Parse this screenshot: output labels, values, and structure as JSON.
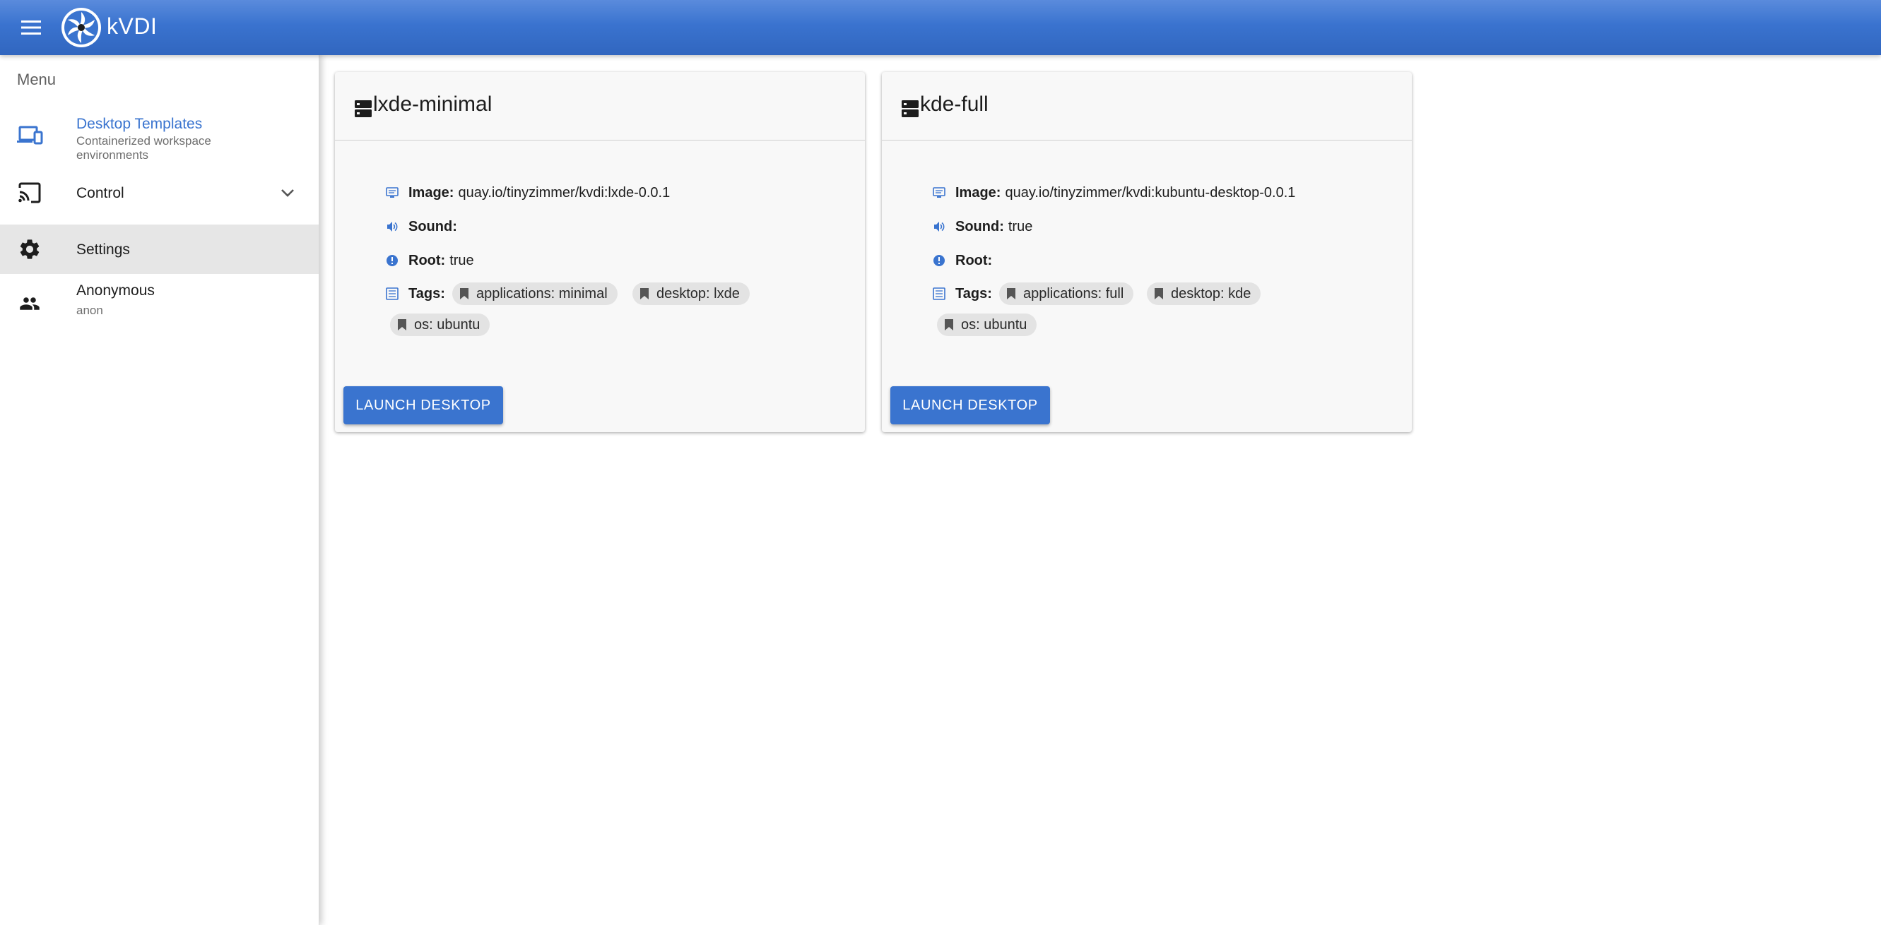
{
  "app": {
    "title": "kVDI",
    "menu_icon": "hamburger-menu-icon",
    "logo_icon": "kvdi-logo-icon"
  },
  "colors": {
    "primary": "#3a74cf",
    "topbar": "#3166bf",
    "selected_bg": "#e6e6e6",
    "chip_bg": "#e3e3e3"
  },
  "sidebar": {
    "header": "Menu",
    "items": [
      {
        "label": "Desktop Templates",
        "sub": "Containerized workspace environments",
        "icon": "devices-icon",
        "active": true
      },
      {
        "label": "Control",
        "sub": "",
        "icon": "cast-icon",
        "expandable": true
      },
      {
        "label": "Settings",
        "sub": "",
        "icon": "gear-icon",
        "selected": true
      },
      {
        "label": "Anonymous",
        "sub": "anon",
        "icon": "users-icon"
      }
    ]
  },
  "templates": [
    {
      "name": "lxde-minimal",
      "image_label": "Image:",
      "image": "quay.io/tinyzimmer/kvdi:lxde-0.0.1",
      "sound_label": "Sound:",
      "sound": "",
      "root_label": "Root:",
      "root": "true",
      "tags_label": "Tags:",
      "tags": [
        "applications: minimal",
        "desktop: lxde",
        "os: ubuntu"
      ],
      "launch_label": "LAUNCH DESKTOP"
    },
    {
      "name": "kde-full",
      "image_label": "Image:",
      "image": "quay.io/tinyzimmer/kvdi:kubuntu-desktop-0.0.1",
      "sound_label": "Sound:",
      "sound": "true",
      "root_label": "Root:",
      "root": "",
      "tags_label": "Tags:",
      "tags": [
        "applications: full",
        "desktop: kde",
        "os: ubuntu"
      ],
      "launch_label": "LAUNCH DESKTOP"
    }
  ]
}
